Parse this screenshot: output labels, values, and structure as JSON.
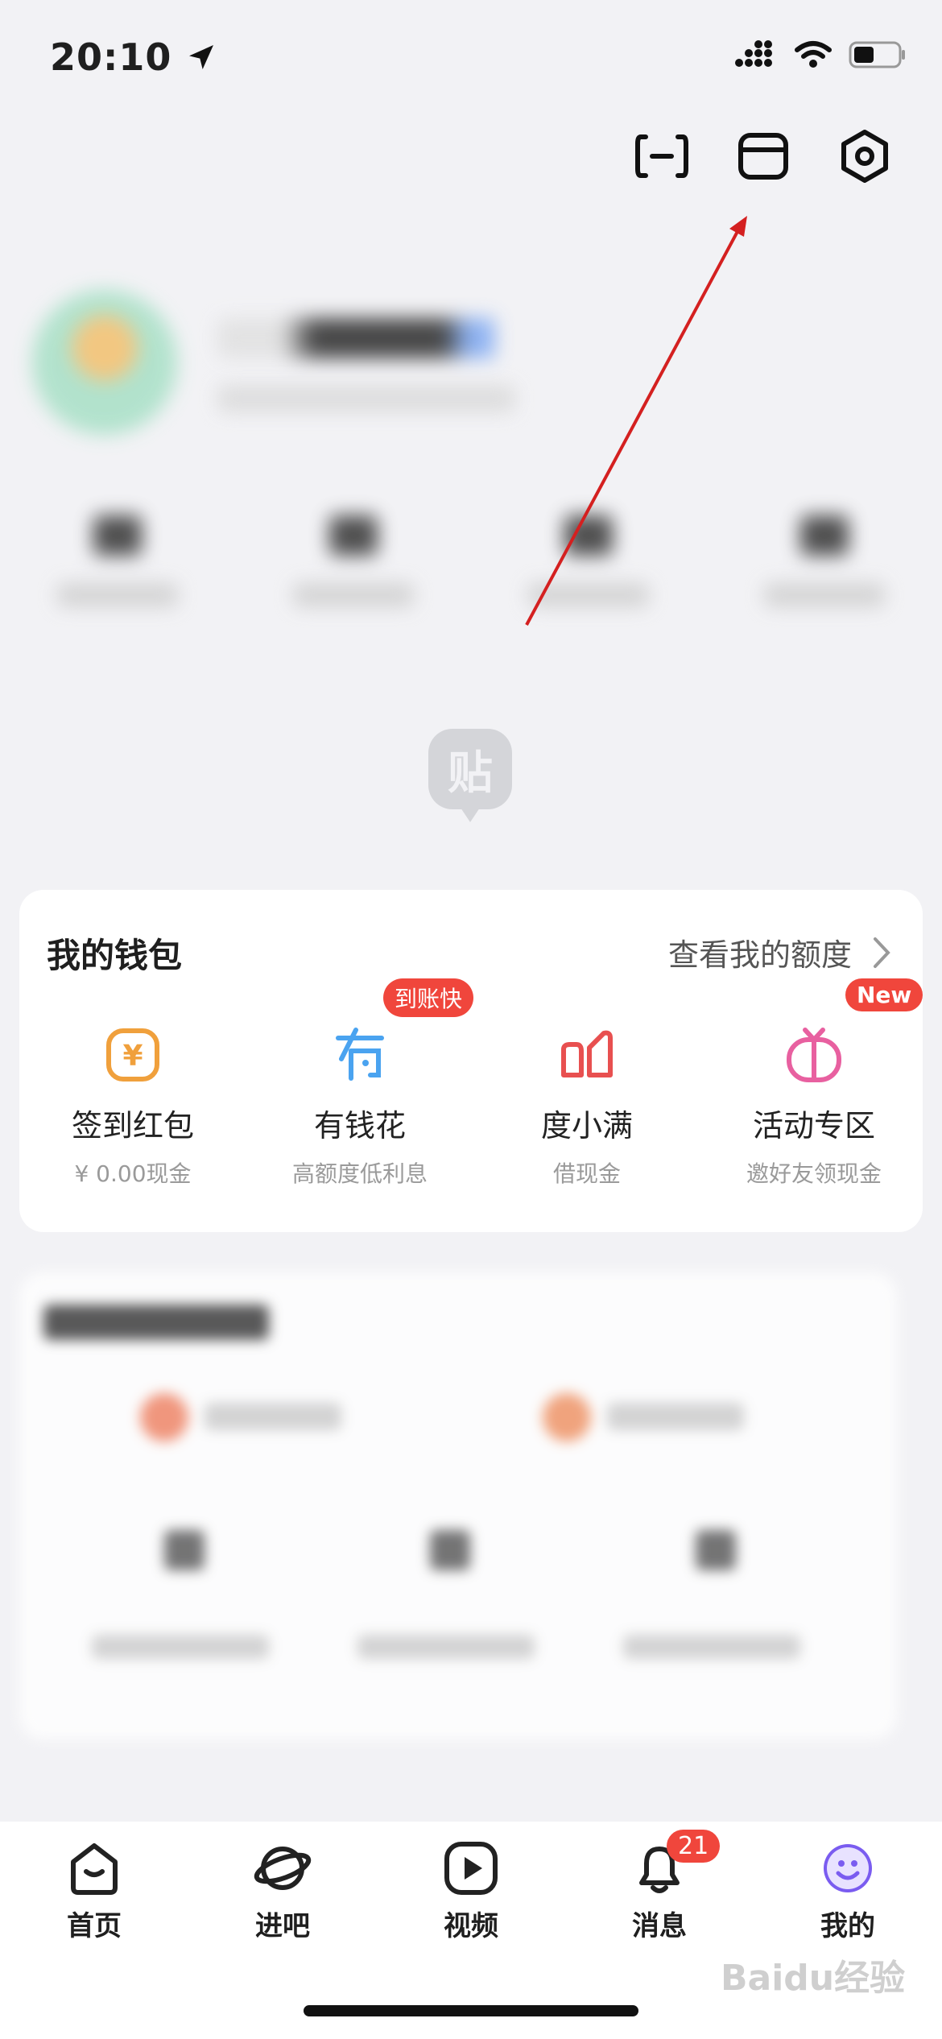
{
  "status_bar": {
    "time": "20:10"
  },
  "wallet": {
    "title": "我的钱包",
    "more_label": "查看我的额度",
    "items": [
      {
        "label": "签到红包",
        "sub": "¥ 0.00现金",
        "badge": ""
      },
      {
        "label": "有钱花",
        "sub": "高额度低利息",
        "badge": "到账快"
      },
      {
        "label": "度小满",
        "sub": "借现金",
        "badge": ""
      },
      {
        "label": "活动专区",
        "sub": "邀好友领现金",
        "badge": "New"
      }
    ]
  },
  "placeholder_icon_text": "贴",
  "tabbar": {
    "tabs": [
      {
        "label": "首页"
      },
      {
        "label": "进吧"
      },
      {
        "label": "视频"
      },
      {
        "label": "消息",
        "badge": "21"
      },
      {
        "label": "我的"
      }
    ]
  },
  "watermark": "Baidu经验",
  "colors": {
    "badge": "#f0463c",
    "annotation_arrow": "#d42020",
    "accent_purple": "#7a5cf0"
  }
}
